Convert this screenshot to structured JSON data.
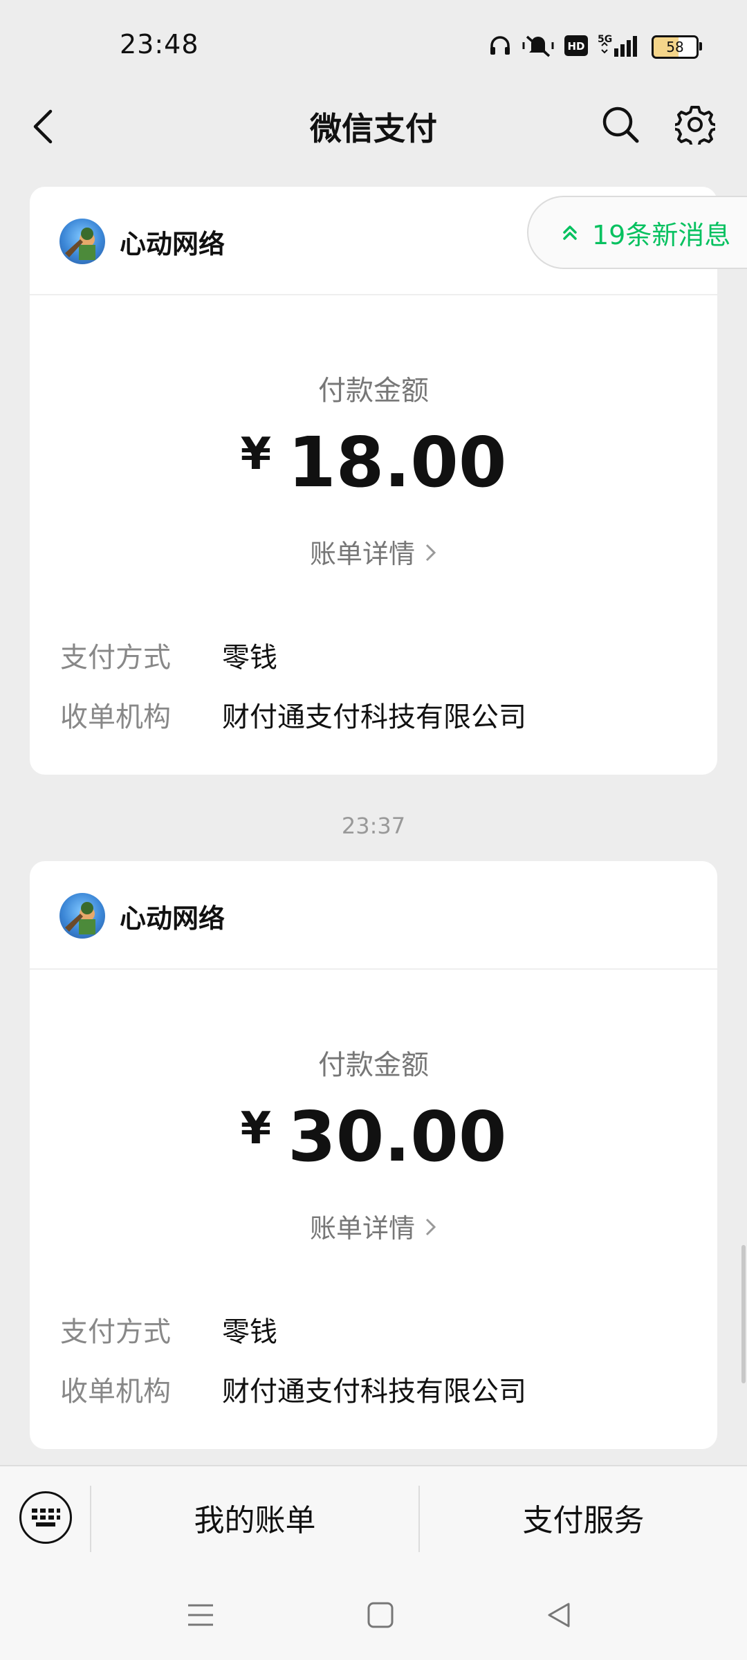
{
  "status_bar": {
    "time": "23:48",
    "network": "5G",
    "hd": "HD",
    "battery": "58",
    "icons": [
      "headphones-icon",
      "vibrate-mute-icon",
      "hd-icon",
      "signal-5g-icon",
      "battery-icon"
    ]
  },
  "nav": {
    "title": "微信支付",
    "back_icon": "back-arrow-icon",
    "search_icon": "search-icon",
    "settings_icon": "gear-icon"
  },
  "new_messages": {
    "label": "19条新消息",
    "icon": "double-chevron-up-icon",
    "color": "#07c160"
  },
  "cards": [
    {
      "merchant": "心动网络",
      "amount_label": "付款金额",
      "currency": "¥",
      "amount": "18.00",
      "detail_link": "账单详情",
      "rows": [
        {
          "label": "支付方式",
          "value": "零钱"
        },
        {
          "label": "收单机构",
          "value": "财付通支付科技有限公司"
        }
      ]
    },
    {
      "merchant": "心动网络",
      "amount_label": "付款金额",
      "currency": "¥",
      "amount": "30.00",
      "detail_link": "账单详情",
      "rows": [
        {
          "label": "支付方式",
          "value": "零钱"
        },
        {
          "label": "收单机构",
          "value": "财付通支付科技有限公司"
        }
      ]
    }
  ],
  "timestamp": "23:37",
  "bottom_menu": {
    "keyboard_icon": "keyboard-icon",
    "items": [
      {
        "label": "我的账单"
      },
      {
        "label": "支付服务"
      }
    ]
  },
  "system_nav": [
    "menu-icon",
    "home-icon",
    "back-icon"
  ]
}
